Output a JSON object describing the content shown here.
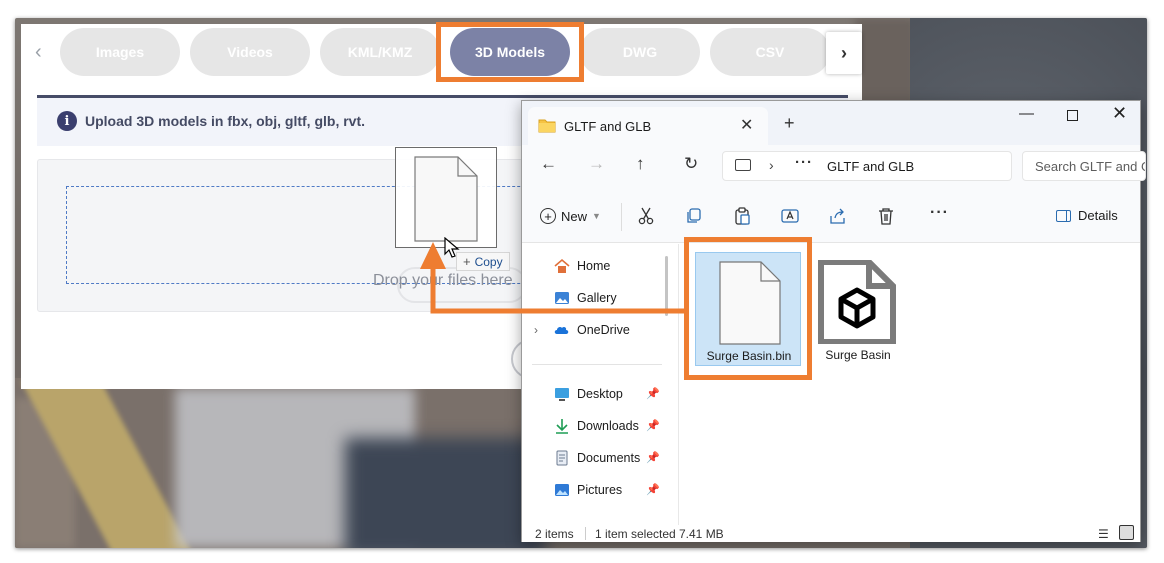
{
  "web": {
    "tabs": [
      {
        "label": "Images",
        "active": false
      },
      {
        "label": "Videos",
        "active": false
      },
      {
        "label": "KML/KMZ",
        "active": false
      },
      {
        "label": "3D Models",
        "active": true
      },
      {
        "label": "DWG",
        "active": false
      },
      {
        "label": "CSV",
        "active": false
      }
    ],
    "info_text": "Upload 3D models in fbx, obj, gltf, glb, rvt.",
    "drop_text": "Drop your files here",
    "copy_tooltip": "Copy",
    "accent_color": "#7c82a6",
    "highlight_color": "#ee7d31"
  },
  "explorer": {
    "tab_title": "GLTF and GLB",
    "address": "GLTF and GLB",
    "search_placeholder": "Search GLTF and GLB",
    "toolbar": {
      "new_label": "New",
      "details_label": "Details"
    },
    "sidebar": [
      {
        "label": "Home",
        "icon": "home-icon"
      },
      {
        "label": "Gallery",
        "icon": "gallery-icon"
      },
      {
        "label": "OneDrive",
        "icon": "onedrive-icon"
      },
      {
        "label": "Desktop",
        "icon": "desktop-icon",
        "pinned": true
      },
      {
        "label": "Downloads",
        "icon": "downloads-icon",
        "pinned": true
      },
      {
        "label": "Documents",
        "icon": "documents-icon",
        "pinned": true
      },
      {
        "label": "Pictures",
        "icon": "pictures-icon",
        "pinned": true
      }
    ],
    "files": [
      {
        "name": "Surge Basin.bin",
        "icon": "blank-file-icon",
        "selected": true
      },
      {
        "name": "Surge Basin",
        "icon": "3d-model-file-icon",
        "selected": false
      }
    ],
    "status": {
      "items": "2 items",
      "selected": "1 item selected",
      "size": "7.41 MB"
    }
  }
}
